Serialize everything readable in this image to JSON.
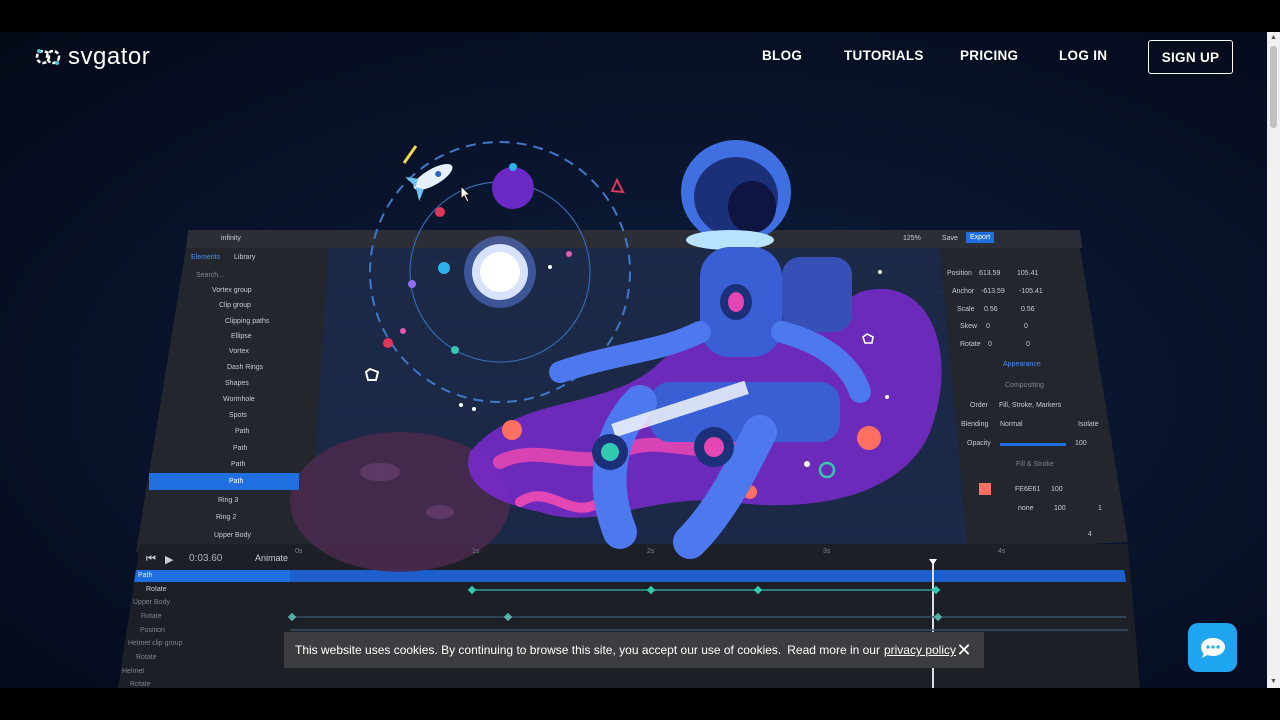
{
  "header": {
    "logo_text": "svgator",
    "nav": [
      "BLOG",
      "TUTORIALS",
      "PRICING",
      "LOG IN"
    ],
    "signup_label": "SIGN UP"
  },
  "editor": {
    "file_name": "infinity",
    "zoom": "125%",
    "save_label": "Save",
    "export_label": "Export",
    "tabs": [
      "Elements",
      "Library"
    ],
    "search_placeholder": "Search...",
    "layers": [
      "Vortex group",
      "Clip group",
      "Clipping paths",
      "Ellipse",
      "Vortex",
      "Dash Rings",
      "Shapes",
      "Wormhole",
      "Spots",
      "Path",
      "Path",
      "Path",
      "Path",
      "Ring 3",
      "Ring 2",
      "Upper Body"
    ],
    "props": {
      "position_label": "Position",
      "position_x": "613.59",
      "position_y": "105.41",
      "anchor_label": "Anchor",
      "anchor_x": "-613.59",
      "anchor_y": "-105.41",
      "scale_label": "Scale",
      "scale_x": "0.56",
      "scale_y": "0.56",
      "skew_label": "Skew",
      "skew_x": "0",
      "skew_y": "0",
      "rotate_label": "Rotate",
      "rotate_x": "0",
      "rotate_y": "0",
      "appearance": "Appearance",
      "compositing": "Compositing",
      "order_label": "Order",
      "order_value": "Fill, Stroke, Markers",
      "blending_label": "Blending",
      "blending_value": "Normal",
      "isolate": "Isolate",
      "opacity_label": "Opacity",
      "opacity_value": "100",
      "fill_stroke": "Fill & Stroke",
      "fill_hex": "FE6E61",
      "fill_opacity": "100",
      "stroke_value": "none",
      "stroke_opacity": "100",
      "stroke_width": "1",
      "corner": "4"
    },
    "timeline": {
      "time": "0:03.60",
      "animate_label": "Animate",
      "ticks": [
        "0s",
        "1s",
        "2s",
        "3s",
        "4s"
      ],
      "rows": [
        "Path",
        "Rotate",
        "Upper Body",
        "Rotate",
        "Position",
        "Helmet clip group",
        "Rotate",
        "Helmet",
        "Rotate"
      ]
    }
  },
  "cookie": {
    "text": "This website uses cookies. By continuing to browse this site, you accept our use of cookies.",
    "read_more": "Read more in our",
    "link": "privacy policy",
    "close": "✕"
  },
  "colors": {
    "accent": "#1f6fe0",
    "chat": "#1fa5f0",
    "keyframe": "#33c9b0",
    "fill_swatch": "#fe6e61"
  }
}
